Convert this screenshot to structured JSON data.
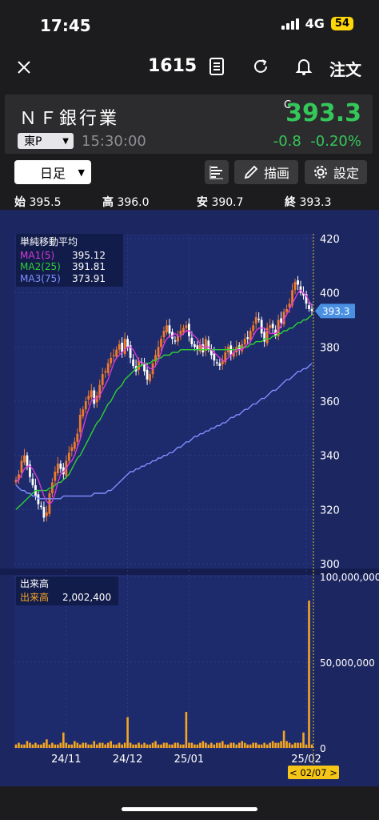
{
  "status_bar": {
    "time": "17:45",
    "network": "4G",
    "battery": "54"
  },
  "nav": {
    "code": "1615",
    "order_label": "注文"
  },
  "quote": {
    "name": "ＮＦ銀行業",
    "market": "東P",
    "time": "15:30:00",
    "c_mark": "C",
    "price": "393.3",
    "change": "-0.8",
    "change_pct": "-0.20%"
  },
  "controls": {
    "period": "日足",
    "draw_label": "描画",
    "settings_label": "設定"
  },
  "ohlc": {
    "open_label": "始",
    "open": "395.5",
    "high_label": "高",
    "high": "396.0",
    "low_label": "安",
    "low": "390.7",
    "close_label": "終",
    "close": "393.3"
  },
  "ma_legend": {
    "title": "単純移動平均",
    "items": [
      {
        "label": "MA1(5)",
        "value": "395.12",
        "color": "#d63ad6"
      },
      {
        "label": "MA2(25)",
        "value": "391.81",
        "color": "#30d030"
      },
      {
        "label": "MA3(75)",
        "value": "373.91",
        "color": "#7f8fff"
      }
    ]
  },
  "volume_legend": {
    "title": "出来高",
    "label": "出来高",
    "value": "2,002,400",
    "color": "#f5a623"
  },
  "current_price_tag": "393.3",
  "cursor_date": "< 02/07 >",
  "colors": {
    "up": "#f07a2c",
    "down": "#ffffff",
    "price_up_text": "#34c759",
    "chart_bg": "#1d2a6b",
    "volume": "#f5a623"
  },
  "chart_data": {
    "type": "candlestick",
    "price_axis": {
      "min": 300,
      "max": 420,
      "ticks": [
        "420",
        "400",
        "380",
        "360",
        "340",
        "320",
        "300"
      ]
    },
    "volume_axis": {
      "min": 0,
      "max": 100000000,
      "ticks": [
        "100,000,000",
        "50,000,000",
        "0"
      ]
    },
    "x_ticks": [
      "24/11",
      "24/12",
      "25/01",
      "25/02"
    ],
    "close": [
      331,
      333,
      338,
      340,
      336,
      332,
      329,
      325,
      322,
      321,
      317,
      319,
      326,
      330,
      334,
      337,
      335,
      333,
      338,
      341,
      343,
      345,
      348,
      355,
      357,
      360,
      362,
      364,
      359,
      362,
      366,
      370,
      371,
      374,
      376,
      377,
      379,
      381,
      378,
      383,
      380,
      376,
      373,
      371,
      375,
      374,
      371,
      368,
      370,
      374,
      377,
      380,
      383,
      386,
      388,
      385,
      383,
      382,
      384,
      386,
      387,
      388,
      384,
      381,
      380,
      379,
      381,
      378,
      383,
      379,
      377,
      375,
      374,
      373,
      375,
      378,
      380,
      377,
      378,
      380,
      379,
      381,
      383,
      383,
      386,
      388,
      391,
      390,
      385,
      382,
      387,
      388,
      387,
      384,
      390,
      389,
      393,
      394,
      396,
      401,
      404,
      403,
      400,
      399,
      396,
      394,
      393.3
    ],
    "ma5": [
      330,
      331,
      333,
      335,
      336,
      336,
      335,
      333,
      331,
      328,
      325,
      323,
      322,
      323,
      326,
      330,
      333,
      334,
      335,
      337,
      338,
      340,
      343,
      346,
      350,
      354,
      357,
      360,
      361,
      361,
      362,
      364,
      366,
      368,
      371,
      374,
      376,
      377,
      378,
      379,
      380,
      380,
      379,
      377,
      375,
      374,
      374,
      373,
      372,
      372,
      373,
      375,
      378,
      381,
      383,
      384,
      384,
      385,
      384,
      384,
      385,
      386,
      386,
      385,
      384,
      383,
      381,
      380,
      380,
      380,
      379,
      378,
      377,
      376,
      375,
      375,
      376,
      377,
      378,
      379,
      379,
      379,
      380,
      381,
      382,
      384,
      386,
      387,
      387,
      387,
      386,
      385,
      385,
      385,
      386,
      388,
      390,
      392,
      394,
      396,
      398,
      400,
      401,
      400,
      399,
      397,
      395.12
    ],
    "ma25": [
      320,
      321,
      322,
      323,
      324,
      325,
      326,
      327,
      327,
      327,
      327,
      327,
      328,
      328,
      329,
      330,
      330,
      331,
      332,
      333,
      335,
      337,
      339,
      340,
      342,
      344,
      346,
      348,
      350,
      352,
      353,
      355,
      357,
      359,
      360,
      362,
      364,
      365,
      366,
      368,
      369,
      370,
      371,
      372,
      373,
      373,
      374,
      374,
      374,
      375,
      375,
      376,
      376,
      377,
      377,
      377,
      378,
      378,
      378,
      379,
      379,
      379,
      379,
      379,
      379,
      379,
      379,
      379,
      379,
      379,
      379,
      379,
      379,
      379,
      379,
      379,
      379,
      379,
      379,
      379,
      380,
      380,
      380,
      380,
      381,
      381,
      382,
      382,
      382,
      383,
      383,
      383,
      384,
      384,
      385,
      385,
      386,
      386,
      387,
      387,
      388,
      389,
      389,
      390,
      390,
      391,
      391.81
    ],
    "ma75": [
      329,
      328,
      327,
      327,
      326,
      326,
      325,
      325,
      324,
      324,
      324,
      324,
      324,
      324,
      324,
      324,
      324,
      325,
      325,
      325,
      325,
      325,
      325,
      325,
      325,
      325,
      325,
      325,
      326,
      326,
      326,
      326,
      326,
      327,
      327,
      328,
      329,
      330,
      331,
      332,
      333,
      334,
      334,
      335,
      335,
      336,
      336,
      337,
      337,
      338,
      338,
      339,
      339,
      340,
      340,
      341,
      341,
      342,
      343,
      343,
      344,
      345,
      345,
      346,
      347,
      347,
      348,
      348,
      349,
      349,
      350,
      350,
      351,
      351,
      352,
      352,
      353,
      354,
      354,
      355,
      355,
      356,
      357,
      357,
      358,
      359,
      359,
      360,
      361,
      361,
      362,
      363,
      364,
      364,
      365,
      366,
      367,
      368,
      368,
      369,
      370,
      371,
      371,
      372,
      372,
      373,
      373.91
    ],
    "volume": [
      2,
      3,
      2,
      2,
      4,
      3,
      2,
      3,
      2,
      2,
      3,
      5,
      2,
      3,
      2,
      2,
      3,
      9,
      3,
      2,
      2,
      4,
      3,
      2,
      3,
      3,
      2,
      2,
      4,
      2,
      3,
      3,
      2,
      3,
      4,
      2,
      2,
      3,
      2,
      3,
      18,
      3,
      2,
      2,
      3,
      2,
      3,
      2,
      2,
      3,
      4,
      2,
      2,
      3,
      3,
      2,
      2,
      3,
      3,
      2,
      2,
      21,
      3,
      3,
      2,
      2,
      3,
      4,
      3,
      2,
      3,
      2,
      3,
      3,
      4,
      2,
      2,
      3,
      3,
      2,
      3,
      4,
      3,
      2,
      2,
      3,
      3,
      2,
      2,
      3,
      2,
      3,
      4,
      3,
      3,
      4,
      10,
      4,
      3,
      2,
      3,
      3,
      3,
      9,
      2,
      86,
      2
    ]
  }
}
